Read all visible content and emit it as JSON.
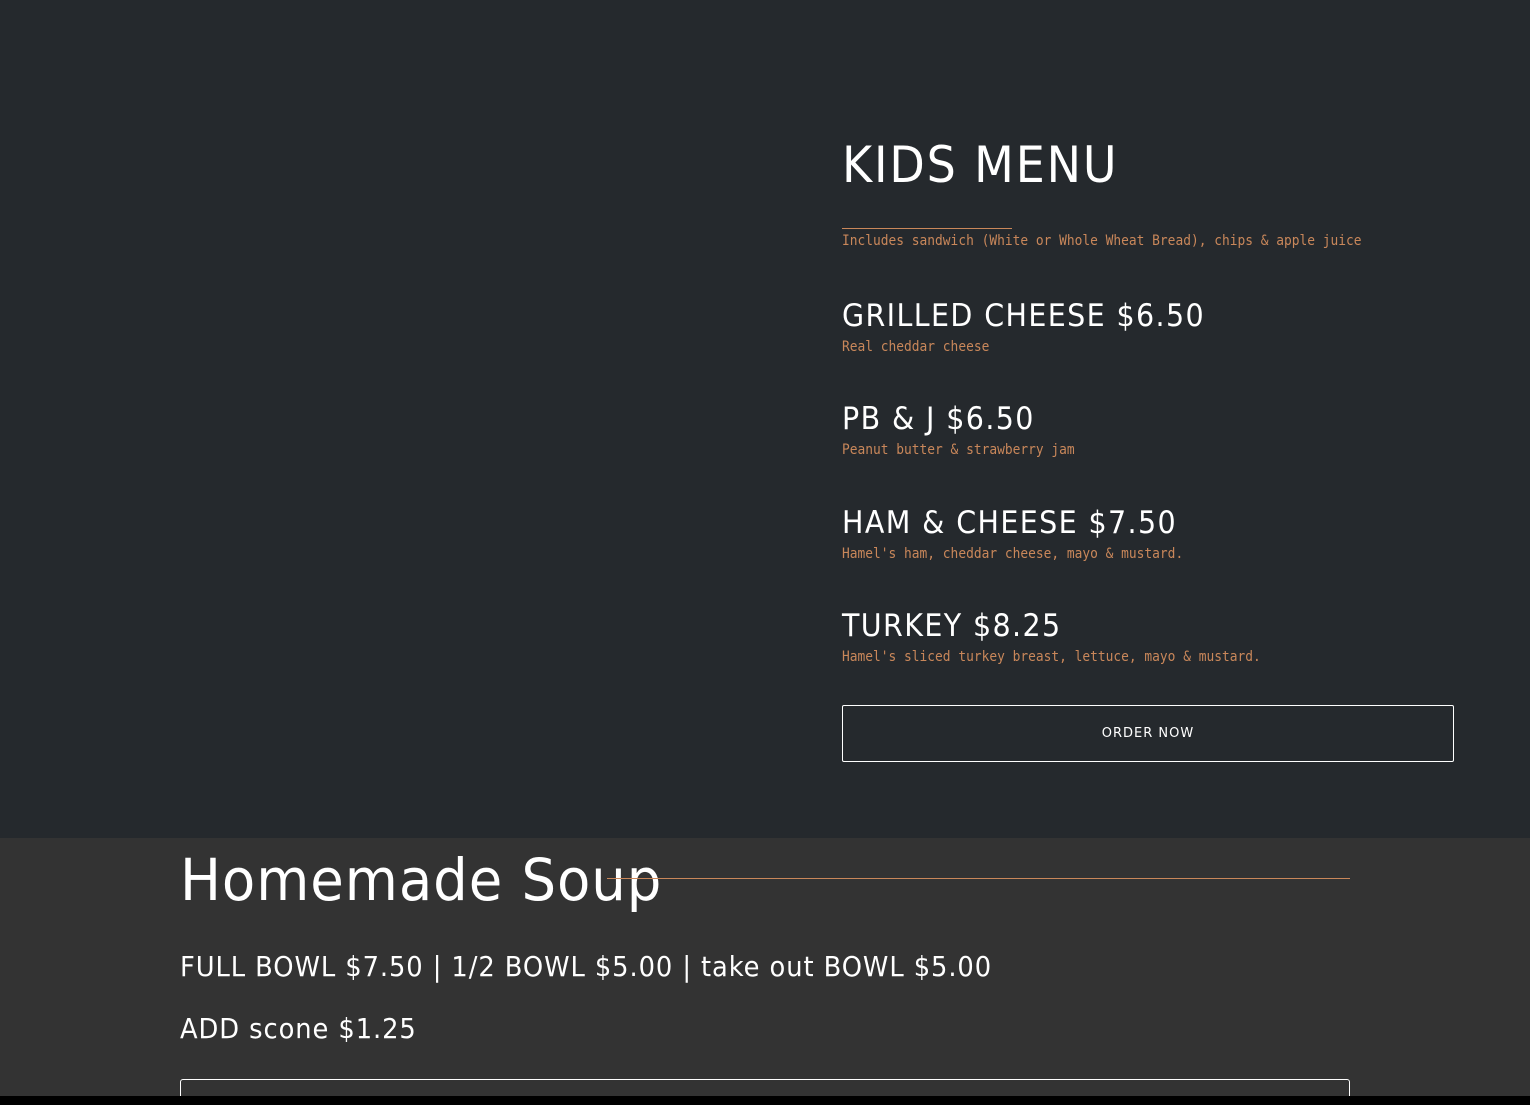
{
  "colors": {
    "top_background": "#25292d",
    "soup_background": "#333333",
    "accent": "#c9875a",
    "text": "#ffffff"
  },
  "kids_menu": {
    "title": "KIDS MENU",
    "subtitle": "Includes sandwich (White or Whole Wheat Bread), chips & apple juice",
    "items": [
      {
        "title": "GRILLED CHEESE $6.50",
        "description": "Real cheddar cheese"
      },
      {
        "title": "PB & J $6.50",
        "description": "Peanut butter & strawberry jam"
      },
      {
        "title": "HAM & CHEESE $7.50",
        "description": "Hamel's ham, cheddar cheese, mayo & mustard."
      },
      {
        "title": "TURKEY $8.25",
        "description": "Hamel's sliced turkey breast, lettuce, mayo & mustard."
      }
    ],
    "order_button": "ORDER NOW"
  },
  "soup": {
    "title": "Homemade Soup",
    "prices": "FULL BOWL $7.50 | 1/2 BOWL $5.00 | take out BOWL $5.00",
    "addon": "ADD scone $1.25"
  }
}
